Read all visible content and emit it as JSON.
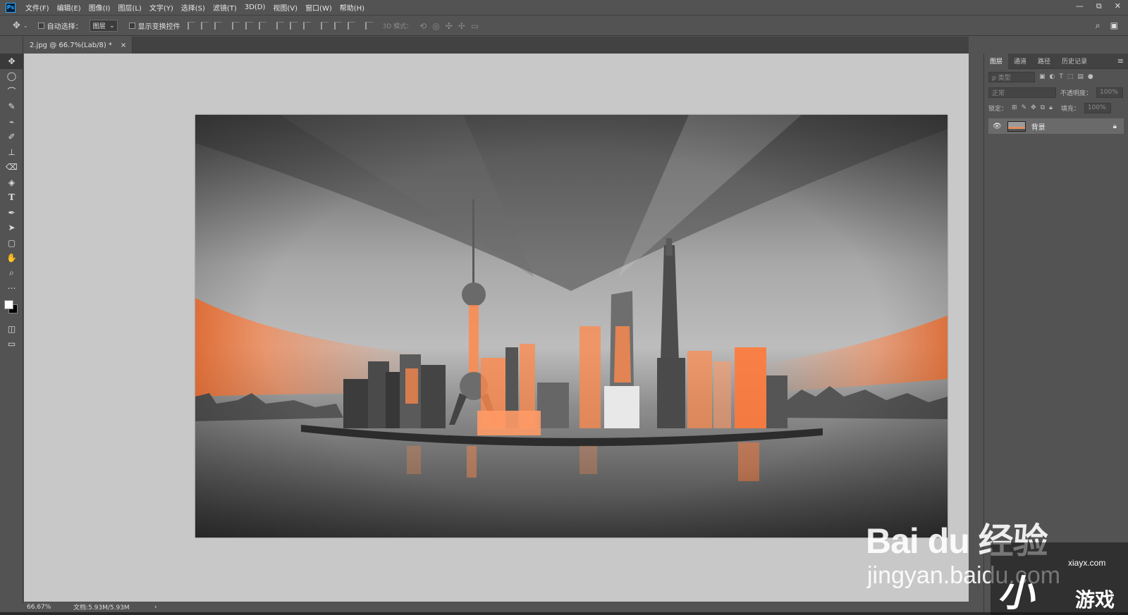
{
  "menubar": {
    "logo": "Ps",
    "items": [
      "文件(F)",
      "编辑(E)",
      "图像(I)",
      "图层(L)",
      "文字(Y)",
      "选择(S)",
      "滤镜(T)",
      "3D(D)",
      "视图(V)",
      "窗口(W)",
      "帮助(H)"
    ],
    "window_buttons": [
      "—",
      "⧉",
      "✕"
    ]
  },
  "options": {
    "auto_select_label": "自动选择：",
    "auto_select_value": "图层",
    "show_transform_label": "显示变换控件",
    "mode_3d_label": "3D 模式："
  },
  "document": {
    "tab_title": "2.jpg @ 66.7%(Lab/8) *",
    "close": "×"
  },
  "status": {
    "zoom": "66.67%",
    "doc_size": "文档:5.93M/5.93M",
    "arrow": "›"
  },
  "layers_panel": {
    "tabs": [
      "图层",
      "通道",
      "路径",
      "历史记录"
    ],
    "filter_placeholder": "ρ 类型",
    "blend_mode": "正常",
    "opacity_label": "不透明度：",
    "opacity_value": "100%",
    "lock_label": "锁定：",
    "fill_label": "填充：",
    "fill_value": "100%",
    "layers": [
      {
        "name": "背景",
        "visible": true,
        "locked": true
      }
    ]
  },
  "watermark": {
    "baidu": "Bai du 经验",
    "url": "jingyan.baidu.com",
    "game_url": "xiayx.com",
    "game_name": "游戏"
  },
  "colors": {
    "ui_bg": "#535353",
    "canvas_bg": "#c8c8c8",
    "accent_orange": "#ff8a4c",
    "ps_blue": "#31a8ff"
  }
}
